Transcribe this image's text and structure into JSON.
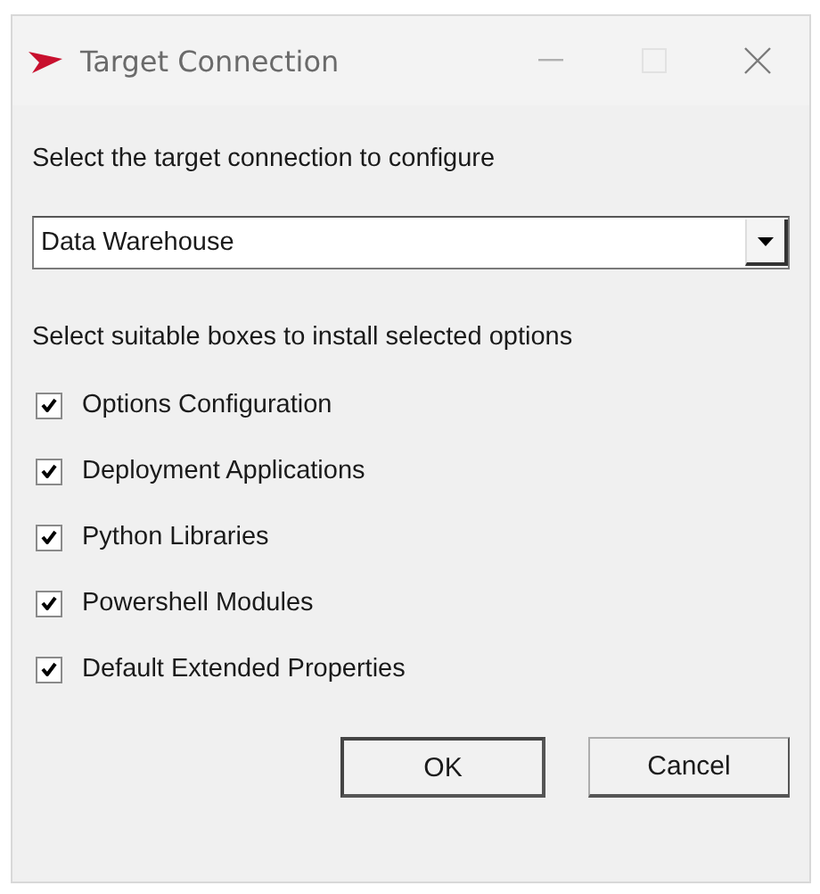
{
  "window": {
    "title": "Target Connection",
    "maximize_disabled": true
  },
  "connection": {
    "label": "Select the target connection to configure",
    "value": "Data Warehouse"
  },
  "options_label": "Select suitable boxes to install selected options",
  "options": [
    {
      "label": "Options Configuration",
      "checked": true
    },
    {
      "label": "Deployment Applications",
      "checked": true
    },
    {
      "label": "Python Libraries",
      "checked": true
    },
    {
      "label": "Powershell Modules",
      "checked": true
    },
    {
      "label": "Default Extended Properties",
      "checked": true
    }
  ],
  "buttons": [
    {
      "label": "OK",
      "default": true
    },
    {
      "label": "Cancel",
      "default": false
    }
  ]
}
